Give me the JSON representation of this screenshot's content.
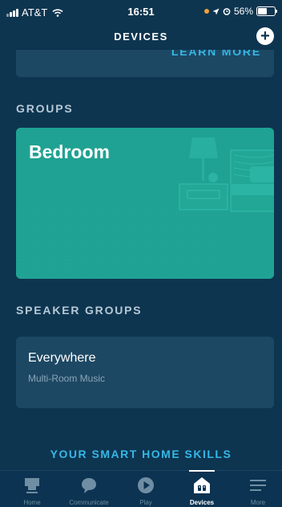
{
  "status_bar": {
    "carrier": "AT&T",
    "time": "16:51",
    "battery_percent": "56%",
    "battery_level": 0.56
  },
  "header": {
    "title": "DEVICES",
    "add_label": "+"
  },
  "learn_more": "LEARN MORE",
  "groups": {
    "title": "GROUPS",
    "items": [
      {
        "name": "Bedroom"
      }
    ]
  },
  "speaker_groups": {
    "title": "SPEAKER GROUPS",
    "items": [
      {
        "name": "Everywhere",
        "subtitle": "Multi-Room Music"
      }
    ]
  },
  "skills_link": "YOUR SMART HOME SKILLS",
  "bottom_nav": {
    "items": [
      {
        "label": "Home",
        "icon": "home-icon"
      },
      {
        "label": "Communicate",
        "icon": "chat-bubble-icon"
      },
      {
        "label": "Play",
        "icon": "play-icon"
      },
      {
        "label": "Devices",
        "icon": "devices-icon",
        "active": true
      },
      {
        "label": "More",
        "icon": "menu-icon"
      }
    ]
  },
  "colors": {
    "background": "#0e3550",
    "card": "#1d4864",
    "group_card": "#1fa293",
    "accent": "#36b7e6"
  }
}
